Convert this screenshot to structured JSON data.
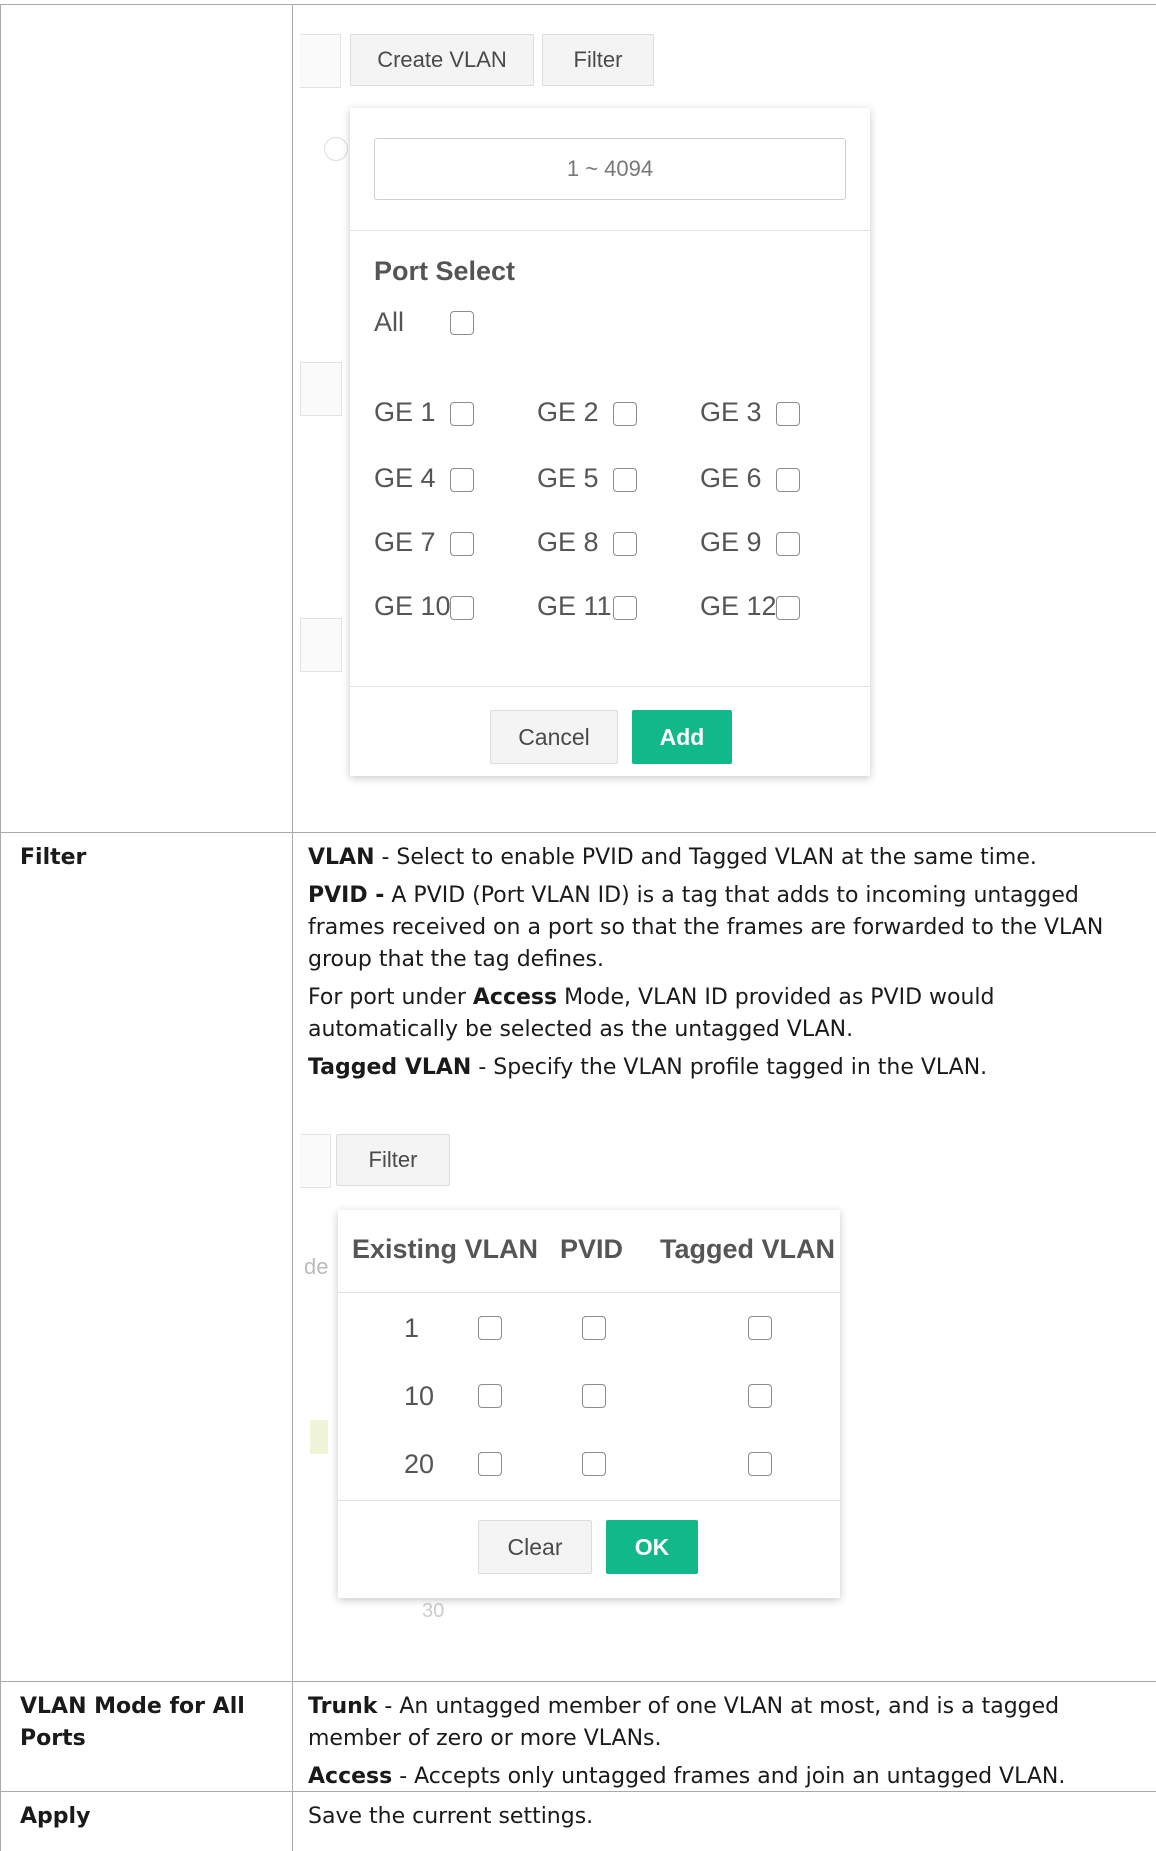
{
  "create_vlan_screenshot": {
    "create_vlan_button": "Create VLAN",
    "filter_button": "Filter",
    "vlan_range_value": "1 ~ 4094",
    "port_select_title": "Port Select",
    "all_label": "All",
    "ports": [
      "GE 1",
      "GE 2",
      "GE 3",
      "GE 4",
      "GE 5",
      "GE 6",
      "GE 7",
      "GE 8",
      "GE 9",
      "GE 10",
      "GE 11",
      "GE 12"
    ],
    "cancel_button": "Cancel",
    "add_button": "Add"
  },
  "filter_row": {
    "label": "Filter",
    "vlan_term": "VLAN",
    "vlan_text": " - Select to enable PVID and Tagged VLAN at the same time.",
    "pvid_term": "PVID -",
    "pvid_text": " A PVID (Port VLAN ID) is a tag that adds to incoming untagged frames received on a port so that the frames are forwarded to the VLAN group that the tag defines.",
    "access_pre": "For port under ",
    "access_term": "Access",
    "access_post": " Mode, VLAN ID provided as PVID would automatically be selected as the untagged VLAN.",
    "tagged_term": "Tagged VLAN",
    "tagged_text": " - Specify the VLAN profile tagged in the VLAN."
  },
  "filter_screenshot": {
    "filter_button": "Filter",
    "col_existing": "Existing VLAN",
    "col_pvid": "PVID",
    "col_tagged": "Tagged VLAN",
    "vlans": [
      "1",
      "10",
      "20"
    ],
    "clear_button": "Clear",
    "ok_button": "OK",
    "ghost_de": "de",
    "ghost_30": "30"
  },
  "vlan_mode_row": {
    "label": "VLAN Mode for All Ports",
    "trunk_term": "Trunk",
    "trunk_text": " - An untagged member of one VLAN at most, and is a tagged member of zero or more VLANs.",
    "access_term": "Access",
    "access_text": " - Accepts only untagged frames and join an untagged VLAN."
  },
  "apply_row": {
    "label": "Apply",
    "text": "Save the current settings."
  },
  "colors": {
    "accent_green": "#11b88a",
    "border": "#a9a9a9"
  }
}
